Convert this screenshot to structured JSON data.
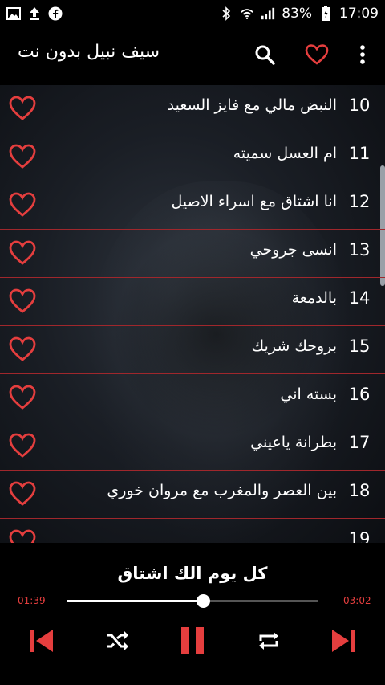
{
  "status_bar": {
    "left_icons": [
      "image-icon",
      "upload-icon",
      "facebook-icon"
    ],
    "right_icons": [
      "bluetooth-icon",
      "wifi-icon",
      "signal-icon",
      "battery-icon"
    ],
    "battery": "83%",
    "time": "17:09"
  },
  "app_bar": {
    "title": "سيف نبيل بدون نت",
    "actions": [
      "search-icon",
      "heart-icon",
      "more-vert-icon"
    ]
  },
  "colors": {
    "accent": "#e53e3e",
    "divider": "#a0272c",
    "background": "#000000"
  },
  "songs": [
    {
      "number": "10",
      "title": "النبض مالي مع فايز السعيد"
    },
    {
      "number": "11",
      "title": "ام العسل سميته"
    },
    {
      "number": "12",
      "title": "انا اشتاق مع اسراء الاصيل"
    },
    {
      "number": "13",
      "title": "انسى جروحي"
    },
    {
      "number": "14",
      "title": "بالدمعة"
    },
    {
      "number": "15",
      "title": "بروحك شريك"
    },
    {
      "number": "16",
      "title": "بسته اني"
    },
    {
      "number": "17",
      "title": "بطرانة ياعيني"
    },
    {
      "number": "18",
      "title": "بين العصر والمغرب مع مروان خوري"
    },
    {
      "number": "19",
      "title": ""
    }
  ],
  "player": {
    "now_playing": "كل يوم الك اشتاق",
    "current_time": "01:39",
    "total_time": "03:02",
    "progress_fraction": 0.544,
    "controls": [
      "previous-icon",
      "shuffle-icon",
      "pause-icon",
      "repeat-icon",
      "next-icon"
    ]
  }
}
